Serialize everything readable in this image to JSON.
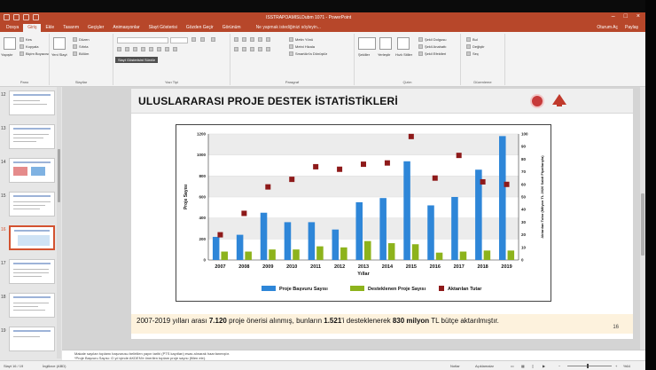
{
  "window": {
    "title": "ISSTRAPOAMISLDubm 1071 - PowerPoint"
  },
  "ribbon": {
    "tabs": [
      "Dosya",
      "Giriş",
      "Ekle",
      "Tasarım",
      "Geçişler",
      "Animasyonlar",
      "Slayt Gösterisi",
      "Gözden Geçir",
      "Görünüm"
    ],
    "active_tab": "Giriş",
    "tell_me": "Ne yapmak istediğinizi söyleyin...",
    "user": "Oturum Aç",
    "share": "Paylaş",
    "groups": [
      "Pano",
      "Slaytlar",
      "Yazı Tipi",
      "Paragraf",
      "Çizim",
      "Düzenleme"
    ],
    "clipboard": {
      "paste": "Yapıştır",
      "cut": "Kes",
      "copy": "Kopyala",
      "format_painter": "Biçim Boyacısı"
    },
    "slides": {
      "new_slide": "Yeni Slayt",
      "layout": "Düzen",
      "reset": "Sıfırla",
      "section": "Bölüm"
    },
    "tooltip": "Slayt Gösterisini Sürdür",
    "paragraph": {
      "text_direction": "Metin Yönü",
      "align_text": "Metni Hizala",
      "smartart": "SmartArt'a Dönüştür"
    },
    "drawing": {
      "shapes": "Şekiller",
      "arrange": "Yerleştir",
      "quick_styles": "Hızlı Stiller",
      "fill": "Şekil Dolgusu",
      "outline": "Şekil Anahattı",
      "effects": "Şekil Efektleri"
    },
    "editing": {
      "find": "Bul",
      "replace": "Değiştir",
      "select": "Seç"
    }
  },
  "thumbnails": [
    "12",
    "13",
    "14",
    "15",
    "16",
    "17",
    "18",
    "19"
  ],
  "selected_thumbnail": "16",
  "slide": {
    "title": "ULUSLARARASI PROJE DESTEK İSTATİSTİKLERİ",
    "caption_parts": {
      "p1": "2007-2019 yılları arası ",
      "b1": "7.120",
      "p2": " proje önerisi alınmış, bunların ",
      "b2": "1.521",
      "p3": "'i desteklenerek ",
      "b3": "830 milyon",
      "p4": " TL bütçe aktarılmıştır."
    },
    "number": "16"
  },
  "notes": {
    "line1": "Makale sayıları toplamı başvurusu belirtilen yayın tarihi (PTS kayıtları) esas alınarak hazırlanmıştır.",
    "line2": "*Proje Başvuru Sayısı: O yıl içinde AKDEN'e önerilen toplam proje sayısı (fiilen ele)."
  },
  "status": {
    "slide_info": "Slayt 16 / 19",
    "language": "İngilizce (ABD)",
    "notes_btn": "Notlar",
    "comments_btn": "Açıklamalar",
    "zoom": "%64"
  },
  "colors": {
    "brand": "#b7472a",
    "bar_blue": "#2e86d8",
    "bar_green": "#8db31c",
    "marker_red": "#8e1a1a"
  },
  "chart_data": {
    "type": "bar",
    "categories": [
      "2007",
      "2008",
      "2009",
      "2010",
      "2011",
      "2012",
      "2013",
      "2014",
      "2015",
      "2016",
      "2017",
      "2018",
      "2019"
    ],
    "xlabel": "Yıllar",
    "ylabel": "Proje Sayısı",
    "y2label": "Aktarılan Tutar (Milyon TL 2020 Sabit Fiyatlarıyla)",
    "ylim": [
      0,
      1200
    ],
    "y2lim": [
      0,
      100
    ],
    "yticks": [
      "0",
      "200",
      "400",
      "600",
      "800",
      "1000",
      "1200"
    ],
    "y2ticks": [
      "0",
      "10",
      "20",
      "30",
      "40",
      "50",
      "60",
      "70",
      "80",
      "90",
      "100"
    ],
    "series": [
      {
        "name": "Proje Başvuru Sayısı",
        "axis": "left",
        "kind": "bar",
        "values": [
          220,
          240,
          450,
          360,
          360,
          290,
          550,
          590,
          940,
          520,
          600,
          860,
          1180
        ]
      },
      {
        "name": "Desteklenen Proje Sayısı",
        "axis": "left",
        "kind": "bar",
        "values": [
          80,
          80,
          100,
          100,
          130,
          120,
          180,
          160,
          150,
          70,
          80,
          90,
          90
        ]
      },
      {
        "name": "Aktarılan Tutar",
        "axis": "right",
        "kind": "marker",
        "values": [
          20,
          37,
          58,
          64,
          74,
          72,
          76,
          77,
          98,
          65,
          83,
          62,
          60
        ]
      }
    ],
    "legend_position": "bottom",
    "grid": true
  }
}
